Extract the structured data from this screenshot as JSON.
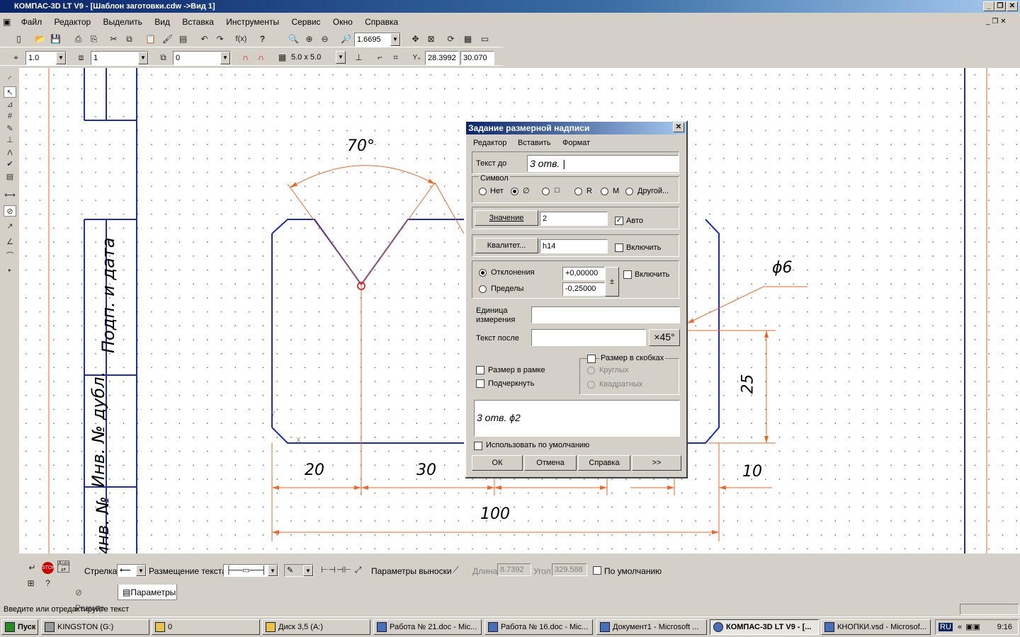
{
  "window": {
    "title": "КОМПАС-3D LT V9 - [Шаблон заготовки.cdw ->Вид 1]"
  },
  "menu": [
    "Файл",
    "Редактор",
    "Выделить",
    "Вид",
    "Вставка",
    "Инструменты",
    "Сервис",
    "Окно",
    "Справка"
  ],
  "toolbar1": {
    "zoom": "1.6695"
  },
  "toolbar2": {
    "line_width": "1.0",
    "layer": "1",
    "style": "0",
    "grid": "5.0 x 5.0",
    "coord_x": "28.3992",
    "coord_y": "30.070"
  },
  "drawing": {
    "sidebar_labels": [
      "Подп. и дата",
      "Инв. № дубл.",
      "инв. №"
    ],
    "dims": {
      "angle": "70°",
      "diameter": "ϕ6",
      "height": "25",
      "d20": "20",
      "d30": "30",
      "d10": "10",
      "d100": "100"
    }
  },
  "dialog": {
    "title": "Задание размерной надписи",
    "menu": [
      "Редактор",
      "Вставить",
      "Формат"
    ],
    "text_before_label": "Текст до",
    "text_before_value": "3 отв. ",
    "symbol_group": "Символ",
    "symbols": [
      "Нет",
      "∅",
      "□",
      "R",
      "M",
      "Другой..."
    ],
    "value_button": "Значение",
    "value": "2",
    "auto_label": "Авто",
    "qualitet_button": "Квалитет...",
    "qualitet": "h14",
    "qualitet_enable": "Включить",
    "deviations_label": "Отклонения",
    "limits_label": "Пределы",
    "dev_upper": "+0,00000",
    "dev_lower": "-0,25000",
    "pm": "±",
    "dev_enable": "Включить",
    "unit_label": "Единица измерения",
    "unit_value": "",
    "text_after_label": "Текст после",
    "text_after_value": "",
    "x45": "×45°",
    "in_frame": "Размер в рамке",
    "underline": "Подчеркнуть",
    "brackets": "Размер в скобках",
    "round": "Круглых",
    "square": "Квадратных",
    "preview": "3 отв. ϕ2",
    "use_default": "Использовать по умолчанию",
    "ok": "ОК",
    "cancel": "Отмена",
    "help": "Справка",
    "more": ">>"
  },
  "propbar": {
    "arrow": "Стрелка",
    "text_placement": "Размещение текста",
    "leader_params": "Параметры выноски",
    "length_label": "Длина",
    "length": "8.7392",
    "angle_label": "Угол",
    "angle": "329.588",
    "default_label": "По умолчанию"
  },
  "tabs": [
    "Размер",
    "Параметры"
  ],
  "status": {
    "text": "Введите или отредактируйте текст"
  },
  "taskbar": {
    "start": "Пуск",
    "tasks": [
      "KINGSTON (G:)",
      "0",
      "Диск 3,5 (A:)",
      "Работа № 21.doc - Mic...",
      "Работа № 16.doc - Mic...",
      "Документ1 - Microsoft ...",
      "КОМПАС-3D LT V9 - [...",
      "КНОПКИ.vsd - Microsof..."
    ],
    "lang": "RU",
    "time": "9:16"
  }
}
